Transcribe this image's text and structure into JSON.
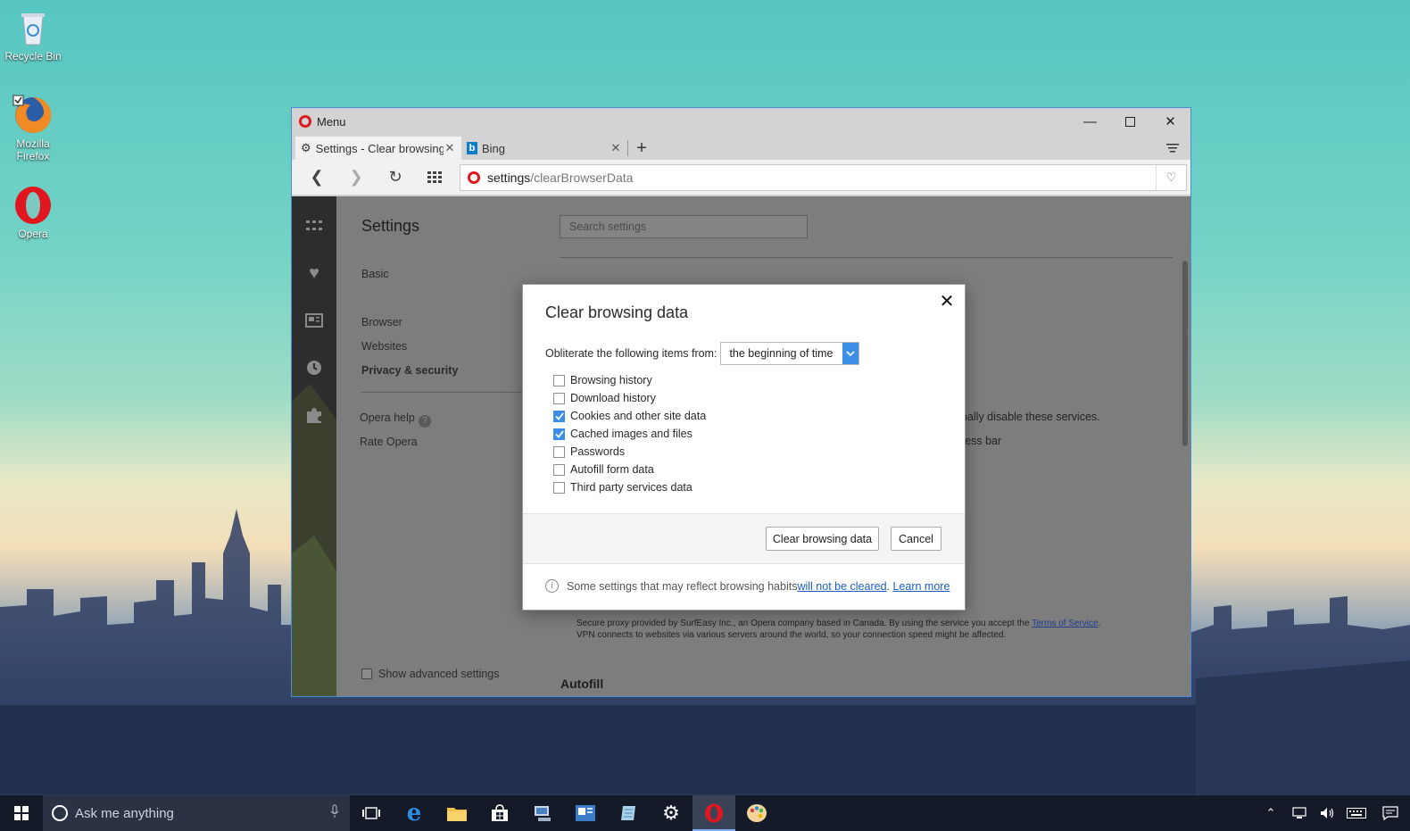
{
  "desktop": {
    "icons": [
      {
        "label": "Recycle Bin"
      },
      {
        "label": "Mozilla Firefox"
      },
      {
        "label": "Opera"
      }
    ]
  },
  "window": {
    "menu_label": "Menu",
    "tabs": [
      {
        "label": "Settings - Clear browsing d",
        "active": true
      },
      {
        "label": "Bing",
        "active": false
      }
    ],
    "address": {
      "host": "settings",
      "path": "/clearBrowserData"
    }
  },
  "settings": {
    "title": "Settings",
    "nav": [
      {
        "label": "Basic"
      },
      {
        "label": "Browser"
      },
      {
        "label": "Websites"
      },
      {
        "label": "Privacy & security"
      }
    ],
    "help_label": "Opera help",
    "help_mark": "?",
    "rate_label": "Rate Opera",
    "show_advanced": "Show advanced settings",
    "search_placeholder": "Search settings",
    "bg_line1": "nally disable these services.",
    "bg_line2": "ress bar",
    "vpn_text_1": "Secure proxy provided by SurfEasy Inc., an Opera company based in Canada. By using the service you accept the ",
    "vpn_tos": "Terms of Service",
    "vpn_text_1_end": ".",
    "vpn_text_2": "VPN connects to websites via various servers around the world, so your connection speed might be affected.",
    "autofill_heading": "Autofill"
  },
  "dialog": {
    "title": "Clear browsing data",
    "obliterate_label": "Obliterate the following items from:",
    "range_value": "the beginning of time",
    "items": [
      {
        "label": "Browsing history",
        "checked": false
      },
      {
        "label": "Download history",
        "checked": false
      },
      {
        "label": "Cookies and other site data",
        "checked": true
      },
      {
        "label": "Cached images and files",
        "checked": true
      },
      {
        "label": "Passwords",
        "checked": false
      },
      {
        "label": "Autofill form data",
        "checked": false
      },
      {
        "label": "Third party services data",
        "checked": false
      }
    ],
    "clear_button": "Clear browsing data",
    "cancel_button": "Cancel",
    "info_mark": "i",
    "info_text": "Some settings that may reflect browsing habits ",
    "info_link1": "will not be cleared",
    "info_sep": ". ",
    "info_link2": "Learn more"
  },
  "taskbar": {
    "search_placeholder": "Ask me anything",
    "apps": [
      "task-view",
      "edge",
      "file-explorer",
      "store",
      "network-app",
      "outlook",
      "notepad",
      "settings",
      "opera",
      "paint"
    ]
  },
  "colors": {
    "accent": "#3d8ee6",
    "opera_red": "#e0171f",
    "window_border": "#4a8cd6"
  }
}
